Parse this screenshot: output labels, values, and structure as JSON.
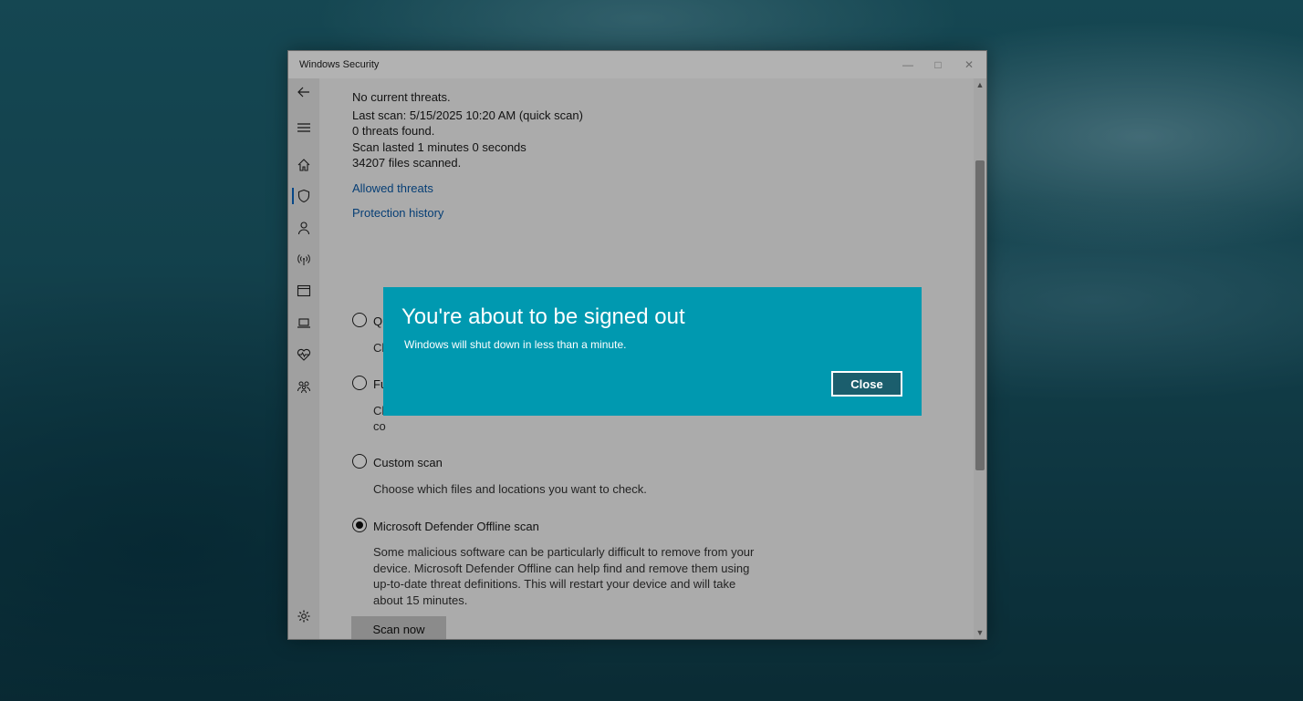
{
  "window": {
    "title": "Windows Security",
    "controls": [
      "—",
      "□",
      "✕"
    ]
  },
  "nav": {
    "icons": [
      "back-arrow-icon",
      "hamburger-menu-icon",
      "home-icon",
      "shield-icon",
      "person-icon",
      "wifi-antenna-icon",
      "app-browser-icon",
      "laptop-icon",
      "health-heart-icon",
      "family-icon",
      "gear-icon"
    ],
    "selected": "shield-icon"
  },
  "status": {
    "line1": "No current threats.",
    "line2": "Last scan: 5/15/2025 10:20 AM (quick scan)",
    "line3": "0 threats found.",
    "line4": "Scan lasted 1 minutes 0 seconds",
    "line5": "34207 files scanned."
  },
  "links": {
    "allowed": "Allowed threats",
    "history": "Protection history"
  },
  "options": {
    "quick": {
      "label": "Quick scan",
      "desc": "Ch"
    },
    "full": {
      "label": "Fu",
      "desc1": "Ch",
      "desc2": "co"
    },
    "custom": {
      "label": "Custom scan",
      "desc": "Choose which files and locations you want to check."
    },
    "offline": {
      "label": "Microsoft Defender Offline scan",
      "desc": "Some malicious software can be particularly difficult to remove from your device. Microsoft Defender Offline can help find and remove them using up-to-date threat definitions. This will restart your device and will take about 15 minutes.",
      "selected": true
    }
  },
  "scan_button": "Scan now",
  "dialog": {
    "title": "You're about to be signed out",
    "message": "Windows will shut down in less than a minute.",
    "close_label": "Close",
    "background": "#0099b0"
  }
}
